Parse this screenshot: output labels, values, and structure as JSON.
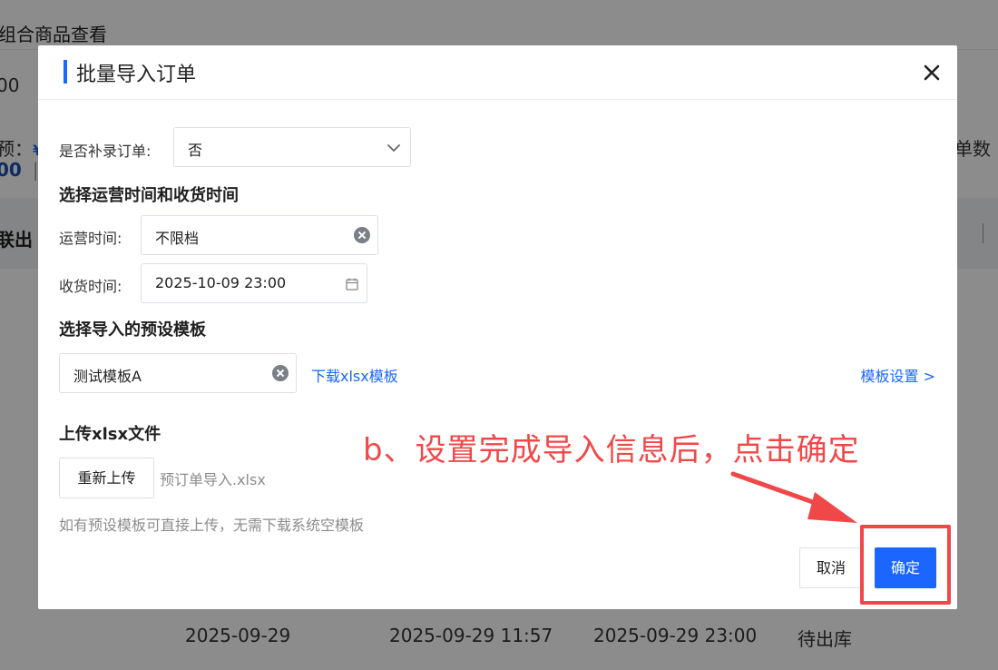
{
  "background": {
    "page_title": "组合商品查看",
    "input_value": "00",
    "amount_label": "预：",
    "amount_symbol": "¥",
    "amount_value": "00",
    "amount_sep": "|",
    "right_label": "单数",
    "toolbar_text": "联出",
    "row": {
      "date": "2025-09-29",
      "created": "2025-09-29 11:57",
      "deadline": "2025-09-29 23:00",
      "status": "待出库"
    }
  },
  "modal": {
    "title": "批量导入订单",
    "supplement": {
      "label": "是否补录订单:",
      "value": "否"
    },
    "time_section": {
      "title": "选择运营时间和收货时间",
      "op_time_label": "运营时间:",
      "op_time_value": "不限档",
      "receive_time_label": "收货时间:",
      "receive_time_value": "2025-10-09 23:00"
    },
    "template_section": {
      "title": "选择导入的预设模板",
      "template_value": "测试模板A",
      "download_link": "下载xlsx模板",
      "settings_link": "模板设置 >"
    },
    "upload_section": {
      "title": "上传xlsx文件",
      "reupload_button": "重新上传",
      "file_name": "预订单导入.xlsx",
      "hint": "如有预设模板可直接上传，无需下载系统空模板"
    },
    "footer": {
      "cancel_button": "取消",
      "confirm_button": "确定"
    }
  },
  "annotation": {
    "text": "b、设置完成导入信息后，点击确定",
    "color": "#f04848"
  },
  "colors": {
    "primary": "#1a66ff",
    "overlay": "rgba(0,0,0,0.45)"
  }
}
